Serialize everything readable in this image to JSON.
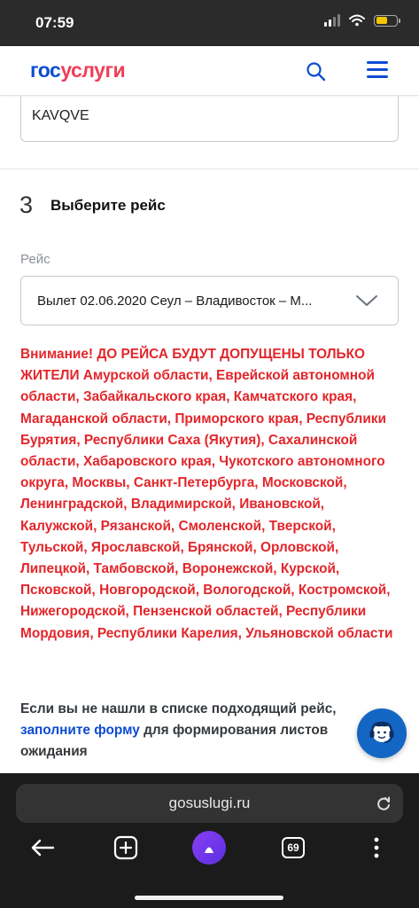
{
  "status_bar": {
    "time": "07:59"
  },
  "header": {
    "logo_part1": "гос",
    "logo_part2": "услуги",
    "icons": [
      "search-icon",
      "menu-icon"
    ],
    "colors": {
      "brand_blue": "#0d4cd3",
      "brand_red": "#ee3f58"
    }
  },
  "code_field": {
    "value": "KAVQVE"
  },
  "step": {
    "number": "3",
    "title": "Выберите рейс"
  },
  "flight_select": {
    "label": "Рейс",
    "value": "Вылет 02.06.2020 Сеул – Владивосток – М..."
  },
  "warning": {
    "text": "Внимание! ДО РЕЙСА БУДУТ ДОПУЩЕНЫ ТОЛЬКО ЖИТЕЛИ Амурской области, Еврейской автономной области, Забайкальского края, Камчатского края, Магаданской области, Приморского края, Республики Бурятия, Республики Саха (Якутия), Сахалинской области, Хабаровского края, Чукотского автономного округа, Москвы, Санкт-Петербурга, Московской, Ленинградской, Владимирской, Ивановской, Калужской, Рязанской, Смоленской, Тверской, Тульской, Ярославской, Брянской, Орловской, Липецкой, Тамбовской, Воронежской, Курской, Псковской, Новгородской, Вологодской, Костромской, Нижегородской, Пензенской областей, Республики Мордовия, Республики Карелия, Ульяновской области",
    "color": "#e3262b"
  },
  "info": {
    "text_before": "Если вы не нашли в списке подходящий рейс, ",
    "link": "заполните форму",
    "text_after": " для формирования листов ожидания"
  },
  "support_button": {
    "icon": "support-agent-icon",
    "color": "#1366c4"
  },
  "browser": {
    "url": "gosuslugi.ru",
    "tab_count": "69",
    "icons": [
      "reload-icon",
      "back-arrow-icon",
      "new-tab-icon",
      "alice-icon",
      "tabs-icon",
      "more-icon"
    ]
  }
}
